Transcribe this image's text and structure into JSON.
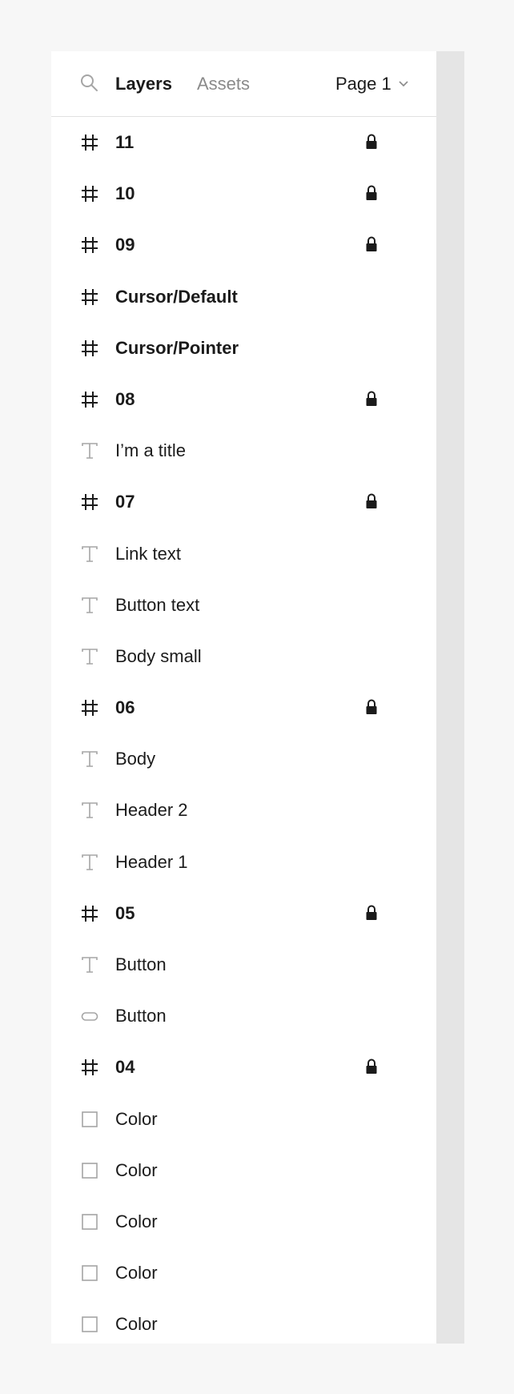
{
  "header": {
    "tabs": [
      {
        "label": "Layers",
        "active": true
      },
      {
        "label": "Assets",
        "active": false
      }
    ],
    "page_selector": "Page 1",
    "search_icon": "search-icon",
    "chevron_icon": "chevron-down-icon"
  },
  "layers": [
    {
      "label": "11",
      "type": "frame",
      "locked": true
    },
    {
      "label": "10",
      "type": "frame",
      "locked": true
    },
    {
      "label": "09",
      "type": "frame",
      "locked": true
    },
    {
      "label": "Cursor/Default",
      "type": "frame",
      "locked": false
    },
    {
      "label": "Cursor/Pointer",
      "type": "frame",
      "locked": false
    },
    {
      "label": "08",
      "type": "frame",
      "locked": true
    },
    {
      "label": "I’m a title",
      "type": "text",
      "locked": false
    },
    {
      "label": "07",
      "type": "frame",
      "locked": true
    },
    {
      "label": "Link text",
      "type": "text",
      "locked": false
    },
    {
      "label": "Button text",
      "type": "text",
      "locked": false
    },
    {
      "label": "Body small",
      "type": "text",
      "locked": false
    },
    {
      "label": "06",
      "type": "frame",
      "locked": true
    },
    {
      "label": "Body",
      "type": "text",
      "locked": false
    },
    {
      "label": "Header 2",
      "type": "text",
      "locked": false
    },
    {
      "label": "Header 1",
      "type": "text",
      "locked": false
    },
    {
      "label": "05",
      "type": "frame",
      "locked": true
    },
    {
      "label": "Button",
      "type": "text",
      "locked": false
    },
    {
      "label": "Button",
      "type": "pill",
      "locked": false
    },
    {
      "label": "04",
      "type": "frame",
      "locked": true
    },
    {
      "label": "Color",
      "type": "rectangle",
      "locked": false
    },
    {
      "label": "Color",
      "type": "rectangle",
      "locked": false
    },
    {
      "label": "Color",
      "type": "rectangle",
      "locked": false
    },
    {
      "label": "Color",
      "type": "rectangle",
      "locked": false
    },
    {
      "label": "Color",
      "type": "rectangle",
      "locked": false
    }
  ],
  "colors": {
    "text": "#1b1b1b",
    "muted": "#8a8a8a",
    "icon_muted": "#a5a5a5",
    "scrollbar": "#e5e5e5"
  }
}
